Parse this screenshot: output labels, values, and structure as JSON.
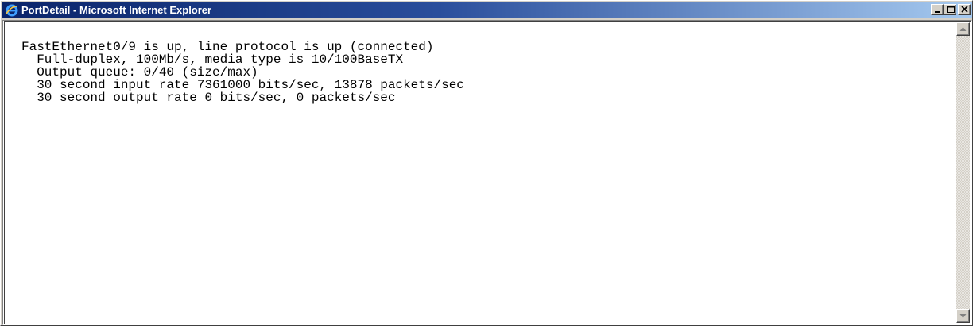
{
  "window": {
    "title": "PortDetail - Microsoft Internet Explorer",
    "icon": "internet-explorer-icon",
    "controls": [
      "minimize",
      "maximize",
      "close"
    ]
  },
  "console": {
    "lines": [
      "FastEthernet0/9 is up, line protocol is up (connected)",
      "  Full-duplex, 100Mb/s, media type is 10/100BaseTX",
      "  Output queue: 0/40 (size/max)",
      "  30 second input rate 7361000 bits/sec, 13878 packets/sec",
      "  30 second output rate 0 bits/sec, 0 packets/sec"
    ]
  },
  "colors": {
    "titlebar_start": "#0a246a",
    "titlebar_end": "#a6caf0",
    "chrome": "#d4d0c8"
  }
}
